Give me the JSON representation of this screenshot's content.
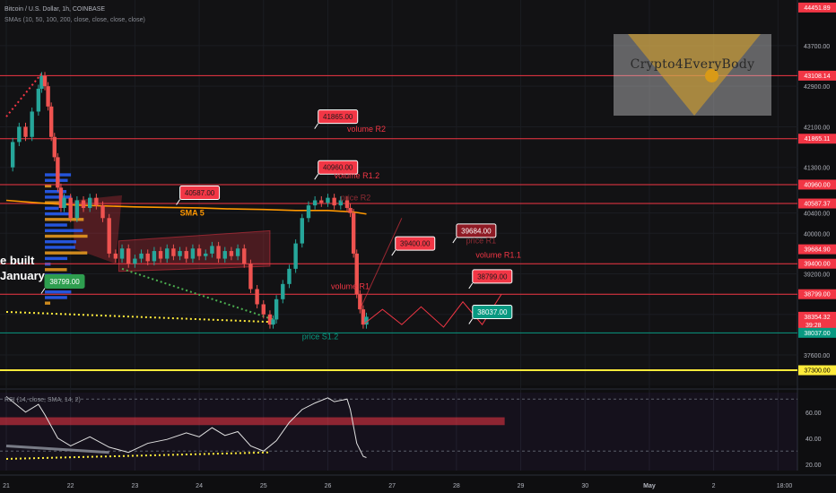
{
  "header": {
    "symbol_line": "Bitcoin / U.S. Dollar, 1h, COINBASE",
    "indicator_line": "SMAs (10, 50, 100, 200, close, close, close, close)"
  },
  "watermark": {
    "text": "Crypto4EveryBody"
  },
  "left_note": {
    "line1": "e built",
    "line2": "January"
  },
  "rsi_header": "RSI (14, close, SMA, 14, 2)",
  "colors": {
    "background": "#0e0e10",
    "level_red": "#f23645",
    "level_green": "#089981",
    "level_yellow": "#ffeb3b",
    "sma": "#ff9800",
    "candle_up": "#26a69a",
    "candle_down": "#ef5350",
    "label_red": "#f23645",
    "label_green": "#089981",
    "annotation_red": "#f23645",
    "annotation_green": "#089981"
  },
  "chart_data": {
    "type": "candlestick",
    "instrument": "Bitcoin / U.S. Dollar",
    "timeframe": "1h",
    "exchange": "COINBASE",
    "ylim": [
      37000,
      44600
    ],
    "x_ticks": [
      "21",
      "22",
      "23",
      "24",
      "25",
      "26",
      "27",
      "28",
      "29",
      "30",
      "May",
      "2",
      "18:00"
    ],
    "x_range_days": [
      21,
      33.3
    ],
    "y_ticks": [
      43700,
      42900,
      42100,
      41300,
      40400,
      40000,
      39200,
      38400,
      37600
    ],
    "y_tick_labels": [
      "43700.00",
      "42900.00",
      "42100.00",
      "41300.00",
      "40400.00",
      "40000.00",
      "39200.00",
      "38400.00",
      "37600.00"
    ],
    "levels": [
      {
        "price": 44451.89,
        "label": "44451.89",
        "kind": "red",
        "line": false
      },
      {
        "price": 43108.14,
        "label": "43108.14",
        "kind": "red",
        "line": true
      },
      {
        "price": 41865.11,
        "label": "41865.11",
        "kind": "red",
        "line": true
      },
      {
        "price": 40960.0,
        "label": "40960.00",
        "kind": "red",
        "line": true
      },
      {
        "price": 40587.37,
        "label": "40587.37",
        "kind": "red",
        "line": true
      },
      {
        "price": 39684.9,
        "label": "39684.90",
        "kind": "red",
        "line": false
      },
      {
        "price": 39400.0,
        "label": "39400.00",
        "kind": "red",
        "line": true
      },
      {
        "price": 38799.0,
        "label": "38799.00",
        "kind": "red",
        "line": true
      },
      {
        "price": 38354.32,
        "label": "38354.32",
        "kind": "red",
        "line": false,
        "countdown": "39:28"
      },
      {
        "price": 38037.0,
        "label": "38037.00",
        "kind": "green",
        "line": true
      },
      {
        "price": 37300.0,
        "label": "37300.00",
        "kind": "yellow",
        "line": true
      }
    ],
    "callouts": [
      {
        "text": "41865.00",
        "x": 25.85,
        "price": 42300,
        "color": "red"
      },
      {
        "text": "40960.00",
        "x": 25.85,
        "price": 41300,
        "color": "red"
      },
      {
        "text": "40587.00",
        "x": 23.7,
        "price": 40800,
        "color": "red"
      },
      {
        "text": "39400.00",
        "x": 27.05,
        "price": 39800,
        "color": "red"
      },
      {
        "text": "39684.00",
        "x": 28.0,
        "price": 40050,
        "color": "darkred"
      },
      {
        "text": "38799.00",
        "x": 28.25,
        "price": 39150,
        "color": "red"
      },
      {
        "text": "38037.00",
        "x": 28.25,
        "price": 38450,
        "color": "green"
      },
      {
        "text": "38799.00",
        "x": 21.6,
        "price": 39050,
        "color": "greenfill"
      }
    ],
    "annotations": [
      {
        "text": "volume R2",
        "x": 26.3,
        "price": 42000,
        "color": "red"
      },
      {
        "text": "volume R1.2",
        "x": 26.1,
        "price": 41080,
        "color": "red"
      },
      {
        "text": "price R2",
        "x": 26.2,
        "price": 40650,
        "color": "darkred"
      },
      {
        "text": "SMA 5",
        "x": 23.7,
        "price": 40350,
        "color": "orange"
      },
      {
        "text": "price R1",
        "x": 28.15,
        "price": 39800,
        "color": "darkred"
      },
      {
        "text": "volume R1.1",
        "x": 28.3,
        "price": 39520,
        "color": "red"
      },
      {
        "text": "volume R1",
        "x": 26.05,
        "price": 38900,
        "color": "red"
      },
      {
        "text": "price S1.2",
        "x": 25.6,
        "price": 37910,
        "color": "green"
      }
    ],
    "price_path": [
      [
        21.0,
        41300
      ],
      [
        21.1,
        41800
      ],
      [
        21.2,
        42100
      ],
      [
        21.3,
        41900
      ],
      [
        21.4,
        42400
      ],
      [
        21.5,
        42850
      ],
      [
        21.55,
        43100
      ],
      [
        21.6,
        42900
      ],
      [
        21.65,
        42500
      ],
      [
        21.7,
        41900
      ],
      [
        21.75,
        41500
      ],
      [
        21.8,
        40900
      ],
      [
        21.85,
        40500
      ],
      [
        21.9,
        40700
      ],
      [
        22.0,
        40300
      ],
      [
        22.1,
        40650
      ],
      [
        22.2,
        40500
      ],
      [
        22.3,
        40700
      ],
      [
        22.4,
        40550
      ],
      [
        22.5,
        40300
      ],
      [
        22.6,
        39600
      ],
      [
        22.7,
        39500
      ],
      [
        22.8,
        39700
      ],
      [
        22.9,
        39400
      ],
      [
        23.0,
        39500
      ],
      [
        23.1,
        39600
      ],
      [
        23.2,
        39450
      ],
      [
        23.3,
        39650
      ],
      [
        23.4,
        39500
      ],
      [
        23.5,
        39700
      ],
      [
        23.6,
        39550
      ],
      [
        23.7,
        39650
      ],
      [
        23.8,
        39500
      ],
      [
        23.9,
        39700
      ],
      [
        24.0,
        39550
      ],
      [
        24.1,
        39600
      ],
      [
        24.2,
        39750
      ],
      [
        24.3,
        39500
      ],
      [
        24.4,
        39650
      ],
      [
        24.5,
        39550
      ],
      [
        24.6,
        39700
      ],
      [
        24.7,
        39400
      ],
      [
        24.8,
        38900
      ],
      [
        24.9,
        38600
      ],
      [
        25.0,
        38400
      ],
      [
        25.1,
        38200
      ],
      [
        25.15,
        38300
      ],
      [
        25.2,
        38700
      ],
      [
        25.3,
        39000
      ],
      [
        25.4,
        39300
      ],
      [
        25.5,
        39800
      ],
      [
        25.6,
        40300
      ],
      [
        25.7,
        40550
      ],
      [
        25.8,
        40650
      ],
      [
        25.9,
        40600
      ],
      [
        26.0,
        40700
      ],
      [
        26.1,
        40550
      ],
      [
        26.2,
        40650
      ],
      [
        26.3,
        40500
      ],
      [
        26.35,
        40400
      ],
      [
        26.4,
        39600
      ],
      [
        26.45,
        38800
      ],
      [
        26.5,
        38500
      ],
      [
        26.55,
        38200
      ],
      [
        26.6,
        38354
      ]
    ],
    "sma_path": [
      [
        21.0,
        40650
      ],
      [
        21.5,
        40600
      ],
      [
        22.0,
        40560
      ],
      [
        22.5,
        40540
      ],
      [
        23.0,
        40520
      ],
      [
        23.5,
        40510
      ],
      [
        24.0,
        40500
      ],
      [
        24.5,
        40480
      ],
      [
        25.0,
        40470
      ],
      [
        25.5,
        40450
      ],
      [
        26.0,
        40450
      ],
      [
        26.4,
        40420
      ],
      [
        26.6,
        40380
      ]
    ],
    "projection_path": [
      [
        26.55,
        38200
      ],
      [
        26.85,
        38500
      ],
      [
        27.15,
        38200
      ],
      [
        27.45,
        38550
      ],
      [
        27.8,
        38150
      ],
      [
        28.1,
        38650
      ],
      [
        28.4,
        38200
      ],
      [
        28.7,
        38800
      ]
    ],
    "rsi": {
      "ylim": [
        15,
        75
      ],
      "y_ticks": [
        60.0,
        40.0,
        20.0
      ],
      "band_upper": [
        50,
        56
      ],
      "overbought": 70,
      "oversold": 30,
      "values": [
        [
          21.0,
          72
        ],
        [
          21.3,
          60
        ],
        [
          21.5,
          66
        ],
        [
          21.6,
          58
        ],
        [
          21.8,
          40
        ],
        [
          22.0,
          34
        ],
        [
          22.3,
          41
        ],
        [
          22.6,
          33
        ],
        [
          22.9,
          29
        ],
        [
          23.2,
          36
        ],
        [
          23.5,
          39
        ],
        [
          23.8,
          44
        ],
        [
          24.0,
          41
        ],
        [
          24.2,
          48
        ],
        [
          24.4,
          42
        ],
        [
          24.6,
          45
        ],
        [
          24.8,
          34
        ],
        [
          25.0,
          30
        ],
        [
          25.2,
          38
        ],
        [
          25.4,
          52
        ],
        [
          25.6,
          62
        ],
        [
          25.8,
          67
        ],
        [
          26.0,
          71
        ],
        [
          26.1,
          68
        ],
        [
          26.3,
          70
        ],
        [
          26.35,
          62
        ],
        [
          26.45,
          36
        ],
        [
          26.55,
          26
        ],
        [
          26.6,
          25
        ]
      ]
    }
  }
}
